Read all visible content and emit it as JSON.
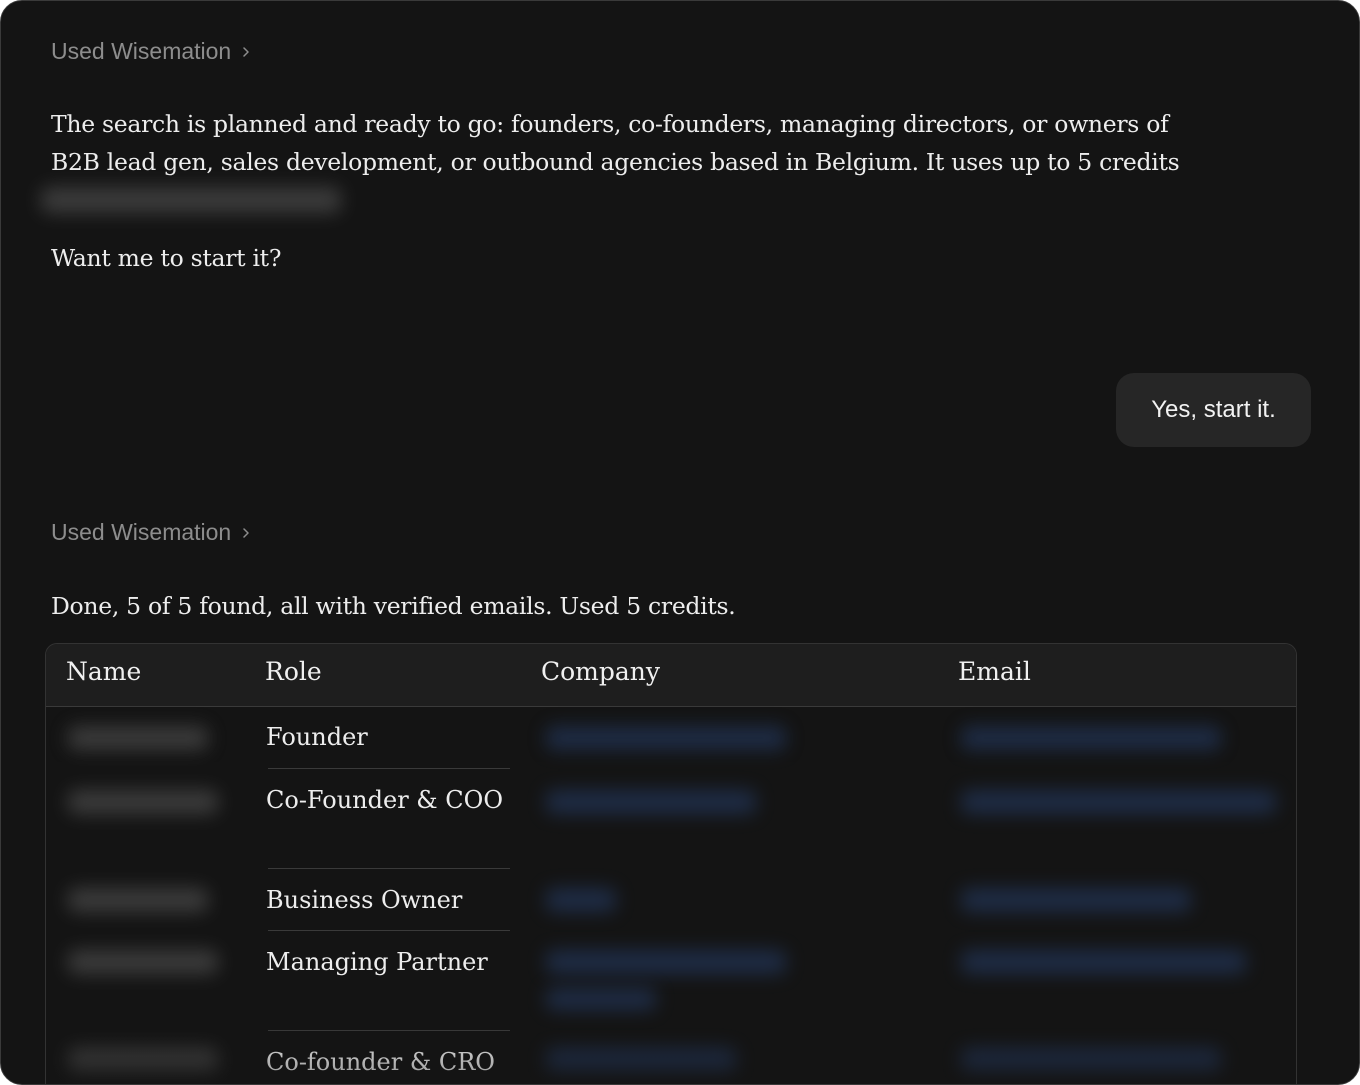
{
  "messages": {
    "tool_label_1": "Used Wisemation",
    "assistant_text_1": "The search is planned and ready to go: founders, co-founders, managing directors, or owners of B2B lead gen, sales development, or outbound agencies based in Belgium. It uses up to 5 credits",
    "assistant_question": "Want me to start it?",
    "user_reply": "Yes, start it.",
    "tool_label_2": "Used Wisemation",
    "assistant_text_2": "Done, 5 of 5 found, all with verified emails. Used 5 credits."
  },
  "table": {
    "headers": {
      "name": "Name",
      "role": "Role",
      "company": "Company",
      "email": "Email"
    },
    "roles": [
      "Founder",
      "Co-Founder & COO",
      "Business Owner",
      "Managing Partner",
      "Co-founder & CRO"
    ]
  },
  "colors": {
    "background": "#141414",
    "bubble": "#262626",
    "muted_text": "#8d8d8d",
    "blurred_link": "#27406e"
  },
  "icons": {
    "tool_chevron": "chevron-right-icon"
  }
}
